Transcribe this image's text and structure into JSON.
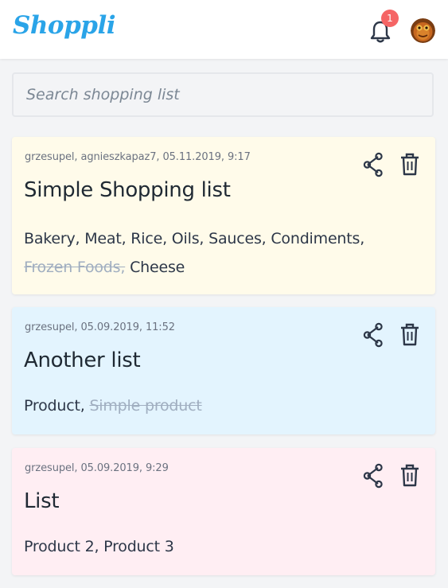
{
  "app": {
    "logo": "Shoppli",
    "notification_count": "1",
    "accent_color": "#2aa4e8",
    "badge_color": "#f56565"
  },
  "search": {
    "placeholder": "Search shopping list",
    "value": ""
  },
  "icons": {
    "notifications": "bell-icon",
    "share": "share-icon",
    "delete": "trash-icon",
    "account": "avatar"
  },
  "lists": [
    {
      "meta": "grzesupel, agnieszkapaz7, 05.11.2019, 9:17",
      "title": "Simple Shopping list",
      "background": "#fffbea",
      "items": [
        {
          "text": "Bakery,",
          "done": false
        },
        {
          "text": "Meat,",
          "done": false
        },
        {
          "text": "Rice,",
          "done": false
        },
        {
          "text": "Oils,",
          "done": false
        },
        {
          "text": "Sauces,",
          "done": false
        },
        {
          "text": "Condiments,",
          "done": false
        },
        {
          "text": "Frozen Foods,",
          "done": true
        },
        {
          "text": "Cheese",
          "done": false
        }
      ]
    },
    {
      "meta": "grzesupel, 05.09.2019, 11:52",
      "title": "Another list",
      "background": "#e3f4fe",
      "items": [
        {
          "text": "Product,",
          "done": false
        },
        {
          "text": "Simple product",
          "done": true
        }
      ]
    },
    {
      "meta": "grzesupel, 05.09.2019, 9:29",
      "title": "List",
      "background": "#ffeef3",
      "items": [
        {
          "text": "Product 2,",
          "done": false
        },
        {
          "text": "Product 3",
          "done": false
        }
      ]
    }
  ]
}
